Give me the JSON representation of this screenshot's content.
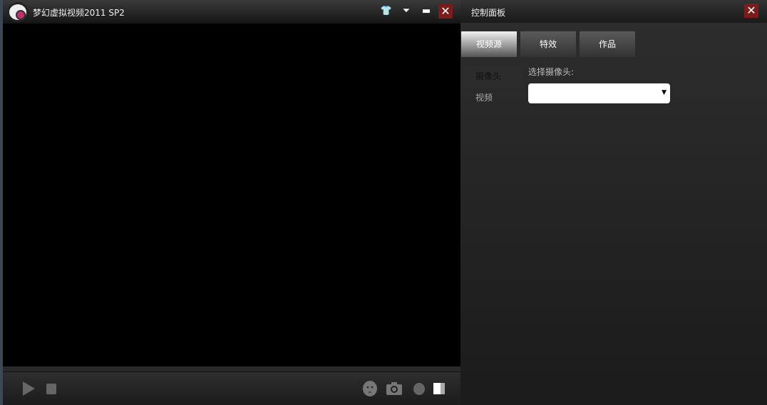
{
  "app": {
    "title": "梦幻虚拟视频2011 SP2",
    "skin_icon": "tshirt-icon",
    "menu_icon": "dropdown-icon",
    "minimize_icon": "minimize-icon",
    "close_icon": "close-icon"
  },
  "controls": {
    "play_icon": "play-icon",
    "stop_icon": "stop-icon",
    "face_icon": "face-icon",
    "camera_icon": "camera-icon",
    "record_icon": "record-icon",
    "panel_icon": "panel-toggle-icon"
  },
  "panel": {
    "title": "控制面板",
    "tabs": [
      {
        "label": "视频源"
      },
      {
        "label": "特效"
      },
      {
        "label": "作品"
      }
    ],
    "side": [
      {
        "label": "摄像头"
      },
      {
        "label": "视频"
      }
    ],
    "select_label": "选择摄像头:",
    "select_value": ""
  },
  "colors": {
    "close_bg": "#7a1c1c"
  }
}
